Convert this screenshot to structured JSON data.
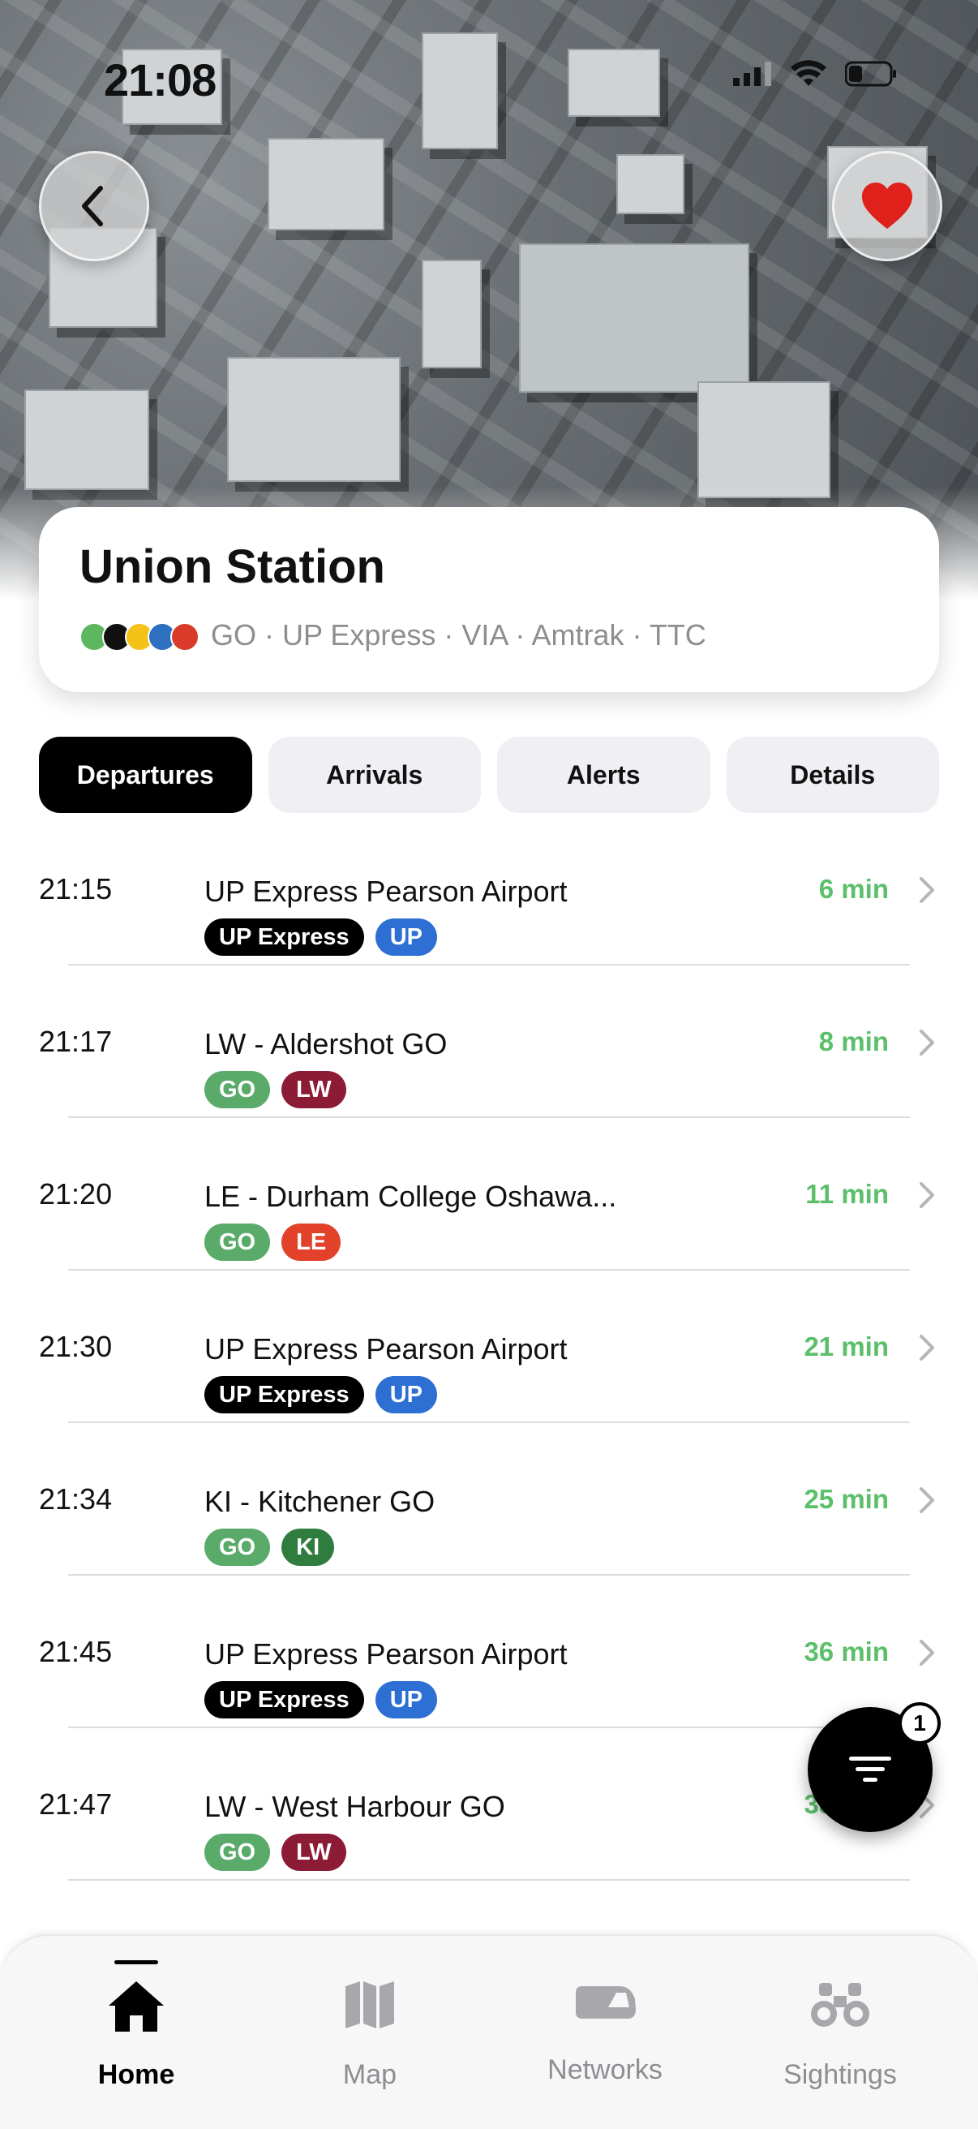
{
  "status_bar": {
    "time": "21:08"
  },
  "header": {
    "back_icon": "chevron-left-icon",
    "favorite_icon": "heart-icon"
  },
  "station": {
    "name": "Union Station",
    "operators": "GO · UP Express · VIA · Amtrak · TTC",
    "operator_colors": [
      "#5cb75f",
      "#111111",
      "#f3c319",
      "#2f6fbf",
      "#d93a2a"
    ]
  },
  "tabs": [
    {
      "label": "Departures",
      "active": true
    },
    {
      "label": "Arrivals",
      "active": false
    },
    {
      "label": "Alerts",
      "active": false
    },
    {
      "label": "Details",
      "active": false
    }
  ],
  "departures": [
    {
      "time": "21:15",
      "destination": "UP Express Pearson Airport",
      "badges": [
        {
          "text": "UP Express",
          "color": "#000000"
        },
        {
          "text": "UP",
          "color": "#2d6fd3"
        }
      ],
      "eta": "6 min"
    },
    {
      "time": "21:17",
      "destination": "LW - Aldershot GO",
      "badges": [
        {
          "text": "GO",
          "color": "#5aaa6a"
        },
        {
          "text": "LW",
          "color": "#8c1b35"
        }
      ],
      "eta": "8 min"
    },
    {
      "time": "21:20",
      "destination": "LE - Durham College Oshawa...",
      "badges": [
        {
          "text": "GO",
          "color": "#5aaa6a"
        },
        {
          "text": "LE",
          "color": "#e2412a"
        }
      ],
      "eta": "11 min"
    },
    {
      "time": "21:30",
      "destination": "UP Express Pearson Airport",
      "badges": [
        {
          "text": "UP Express",
          "color": "#000000"
        },
        {
          "text": "UP",
          "color": "#2d6fd3"
        }
      ],
      "eta": "21 min"
    },
    {
      "time": "21:34",
      "destination": "KI - Kitchener GO",
      "badges": [
        {
          "text": "GO",
          "color": "#5aaa6a"
        },
        {
          "text": "KI",
          "color": "#2e7d3e"
        }
      ],
      "eta": "25 min"
    },
    {
      "time": "21:45",
      "destination": "UP Express Pearson Airport",
      "badges": [
        {
          "text": "UP Express",
          "color": "#000000"
        },
        {
          "text": "UP",
          "color": "#2d6fd3"
        }
      ],
      "eta": "36 min"
    },
    {
      "time": "21:47",
      "destination": "LW - West Harbour GO",
      "badges": [
        {
          "text": "GO",
          "color": "#5aaa6a"
        },
        {
          "text": "LW",
          "color": "#8c1b35"
        }
      ],
      "eta": "38 min"
    }
  ],
  "filter": {
    "icon": "filter-icon",
    "count": "1"
  },
  "tabbar": [
    {
      "label": "Home",
      "icon": "house-icon",
      "active": true
    },
    {
      "label": "Map",
      "icon": "map-icon",
      "active": false
    },
    {
      "label": "Networks",
      "icon": "train-icon",
      "active": false
    },
    {
      "label": "Sightings",
      "icon": "binoculars-icon",
      "active": false
    }
  ],
  "colors": {
    "eta_green": "#5cbf6a",
    "favorite_red": "#e0201b"
  }
}
